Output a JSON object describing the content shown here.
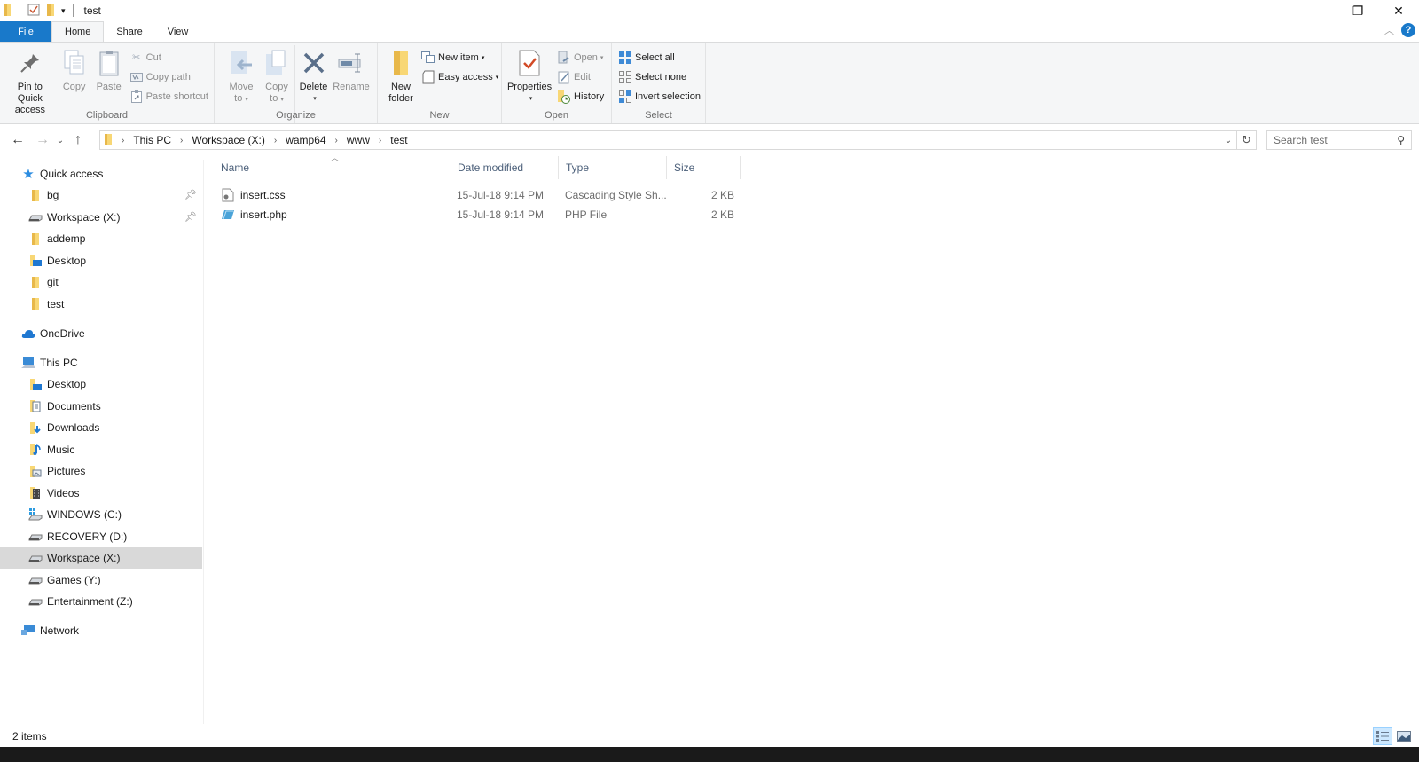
{
  "window": {
    "title": "test",
    "controls": {
      "minimize": "—",
      "maximize": "❐",
      "close": "✕"
    }
  },
  "ribbon_tabs": [
    {
      "label": "File"
    },
    {
      "label": "Home"
    },
    {
      "label": "Share"
    },
    {
      "label": "View"
    }
  ],
  "ribbon": {
    "clipboard": {
      "label": "Clipboard",
      "pin_line1": "Pin to Quick",
      "pin_line2": "access",
      "copy": "Copy",
      "paste": "Paste",
      "cut": "Cut",
      "copy_path": "Copy path",
      "paste_shortcut": "Paste shortcut"
    },
    "organize": {
      "label": "Organize",
      "move_line1": "Move",
      "move_line2": "to",
      "copy_line1": "Copy",
      "copy_line2": "to",
      "delete": "Delete",
      "rename": "Rename"
    },
    "new": {
      "label": "New",
      "folder_line1": "New",
      "folder_line2": "folder",
      "new_item": "New item",
      "easy_access": "Easy access"
    },
    "open": {
      "label": "Open",
      "properties": "Properties",
      "open": "Open",
      "edit": "Edit",
      "history": "History"
    },
    "select": {
      "label": "Select",
      "select_all": "Select all",
      "select_none": "Select none",
      "invert": "Invert selection"
    }
  },
  "address": {
    "breadcrumb": [
      "This PC",
      "Workspace (X:)",
      "wamp64",
      "www",
      "test"
    ],
    "search_placeholder": "Search test"
  },
  "navpane": {
    "quick_access": {
      "label": "Quick access",
      "items": [
        {
          "label": "bg",
          "icon": "folder",
          "pinned": true
        },
        {
          "label": "Workspace (X:)",
          "icon": "drive",
          "pinned": true
        },
        {
          "label": "addemp",
          "icon": "folder",
          "pinned": false
        },
        {
          "label": "Desktop",
          "icon": "desktop-folder",
          "pinned": false
        },
        {
          "label": "git",
          "icon": "folder",
          "pinned": false
        },
        {
          "label": "test",
          "icon": "folder",
          "pinned": false
        }
      ]
    },
    "onedrive": "OneDrive",
    "this_pc": {
      "label": "This PC",
      "items": [
        {
          "label": "Desktop",
          "icon": "desktop-folder"
        },
        {
          "label": "Documents",
          "icon": "documents-folder"
        },
        {
          "label": "Downloads",
          "icon": "downloads-folder"
        },
        {
          "label": "Music",
          "icon": "music-folder"
        },
        {
          "label": "Pictures",
          "icon": "pictures-folder"
        },
        {
          "label": "Videos",
          "icon": "videos-folder"
        },
        {
          "label": "WINDOWS (C:)",
          "icon": "windows-drive"
        },
        {
          "label": "RECOVERY (D:)",
          "icon": "drive"
        },
        {
          "label": "Workspace (X:)",
          "icon": "drive",
          "selected": true
        },
        {
          "label": "Games (Y:)",
          "icon": "drive"
        },
        {
          "label": "Entertainment (Z:)",
          "icon": "drive"
        }
      ]
    },
    "network": "Network"
  },
  "filelist": {
    "columns": [
      "Name",
      "Date modified",
      "Type",
      "Size"
    ],
    "rows": [
      {
        "name": "insert.css",
        "date": "15-Jul-18 9:14 PM",
        "type": "Cascading Style Sh...",
        "size": "2 KB"
      },
      {
        "name": "insert.php",
        "date": "15-Jul-18 9:14 PM",
        "type": "PHP File",
        "size": "2 KB"
      }
    ]
  },
  "status": {
    "item_count": "2 items"
  },
  "colors": {
    "file_tab": "#1979ca",
    "ribbon_bg": "#f5f6f7",
    "folder_yellow": "#f8d775",
    "selected_nav": "#d9d9d9",
    "header_text": "#4c607a"
  }
}
